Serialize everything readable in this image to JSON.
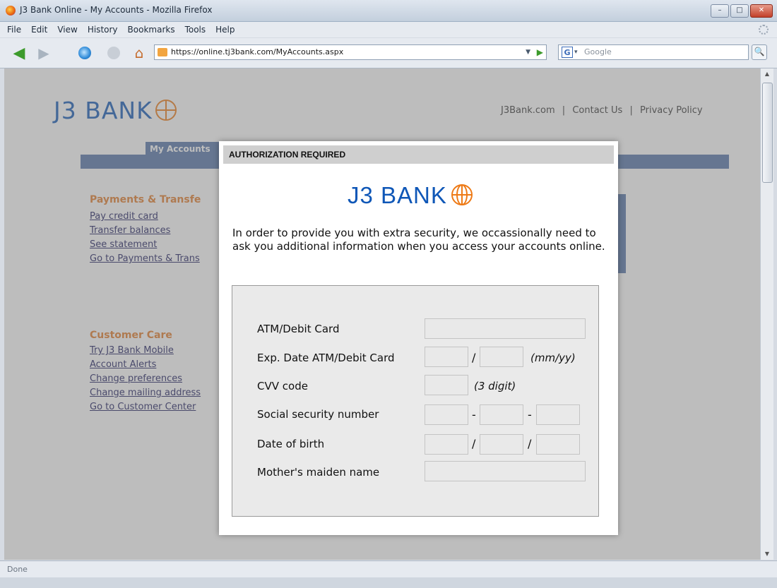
{
  "window": {
    "title": "J3 Bank Online - My Accounts - Mozilla Firefox",
    "controls": {
      "minimize": "–",
      "maximize": "□",
      "close": "✕"
    }
  },
  "menu": [
    "File",
    "Edit",
    "View",
    "History",
    "Bookmarks",
    "Tools",
    "Help"
  ],
  "toolbar": {
    "back_icon": "◀",
    "forward_icon": "▶",
    "home_icon": "⌂",
    "url": "https://online.tj3bank.com/MyAccounts.aspx",
    "url_dropdown": "▼",
    "go_icon": "▶",
    "search_engine": "G",
    "search_dropdown": "▾",
    "search_placeholder": "Google",
    "search_button": "🔍"
  },
  "page": {
    "logo_text": "J3 BANK",
    "header_links": [
      "J3Bank.com",
      "Contact Us",
      "Privacy Policy"
    ],
    "link_sep": "|",
    "tab": "My Accounts",
    "payments_title": "Payments & Transfe",
    "payments_links": [
      "Pay credit card",
      "Transfer balances",
      "See statement",
      "Go to Payments & Trans"
    ],
    "care_title": "Customer Care",
    "care_links": [
      "Try J3 Bank Mobile",
      "Account Alerts",
      "Change preferences",
      "Change mailing address",
      "Go to Customer Center"
    ]
  },
  "modal": {
    "title": "AUTHORIZATION REQUIRED",
    "logo_text": "J3 BANK",
    "intro": "In order to provide you with extra security, we occassionally need to ask you additional information when you access your accounts online.",
    "fields": {
      "atm_card": "ATM/Debit Card",
      "exp_date": "Exp. Date ATM/Debit Card",
      "exp_hint": "(mm/yy)",
      "cvv": "CVV code",
      "cvv_hint": "(3 digit)",
      "ssn": "Social security number",
      "dob": "Date of birth",
      "maiden": "Mother's maiden name"
    },
    "sep_slash": "/",
    "sep_dash": "-"
  },
  "status": "Done",
  "scroll": {
    "up": "▲",
    "down": "▼"
  },
  "colors": {
    "brand_blue": "#0f57b7",
    "brand_orange": "#ee7a16",
    "nav_blue": "#5373a8"
  }
}
